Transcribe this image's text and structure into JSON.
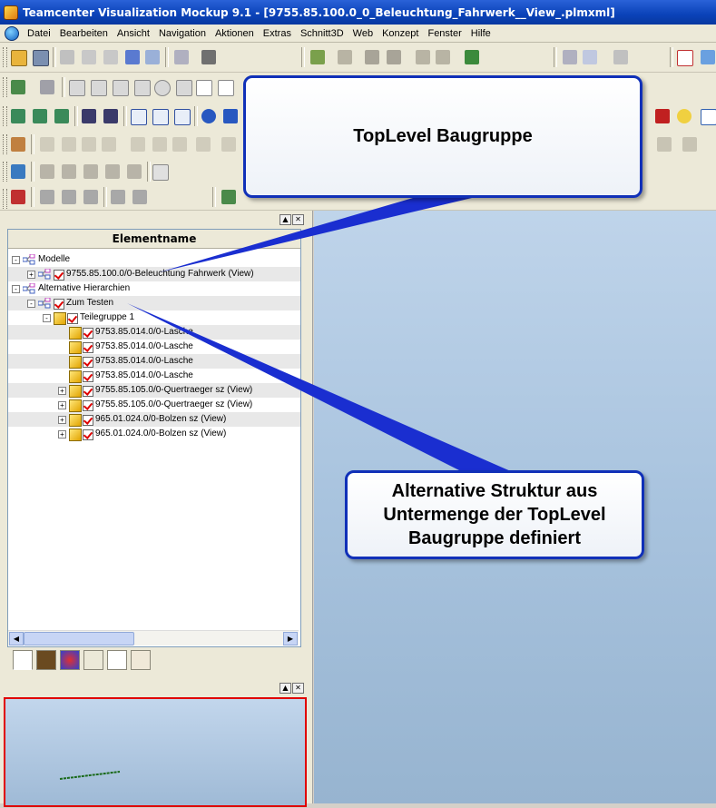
{
  "window": {
    "title": "Teamcenter Visualization Mockup 9.1 - [9755.85.100.0_0_Beleuchtung_Fahrwerk__View_.plmxml]"
  },
  "menu": [
    "Datei",
    "Bearbeiten",
    "Ansicht",
    "Navigation",
    "Aktionen",
    "Extras",
    "Schnitt3D",
    "Web",
    "Konzept",
    "Fenster",
    "Hilfe"
  ],
  "tree": {
    "column_header": "Elementname",
    "rows": [
      {
        "label": "Modelle",
        "indent": 0,
        "icon": "model-group-icon",
        "expander": "-"
      },
      {
        "label": "9755.85.100.0/0-Beleuchtung Fahrwerk (View)",
        "indent": 1,
        "icon": "model-group-icon",
        "check": true,
        "expander": "+"
      },
      {
        "label": "Alternative Hierarchien",
        "indent": 0,
        "icon": "model-group-icon",
        "expander": "-"
      },
      {
        "label": "Zum Testen",
        "indent": 1,
        "icon": "model-group-icon",
        "check": true,
        "expander": "-"
      },
      {
        "label": "Teilegruppe 1",
        "indent": 2,
        "icon": "part-group-icon",
        "check": true,
        "expander": "-"
      },
      {
        "label": "9753.85.014.0/0-Lasche",
        "indent": 3,
        "icon": "part-icon",
        "check": true,
        "expander": ""
      },
      {
        "label": "9753.85.014.0/0-Lasche",
        "indent": 3,
        "icon": "part-icon",
        "check": true,
        "expander": ""
      },
      {
        "label": "9753.85.014.0/0-Lasche",
        "indent": 3,
        "icon": "part-icon",
        "check": true,
        "expander": ""
      },
      {
        "label": "9753.85.014.0/0-Lasche",
        "indent": 3,
        "icon": "part-icon",
        "check": true,
        "expander": ""
      },
      {
        "label": "9755.85.105.0/0-Quertraeger sz (View)",
        "indent": 3,
        "icon": "part-icon",
        "check": true,
        "expander": "+"
      },
      {
        "label": "9755.85.105.0/0-Quertraeger sz (View)",
        "indent": 3,
        "icon": "part-icon",
        "check": true,
        "expander": "+"
      },
      {
        "label": "965.01.024.0/0-Bolzen sz (View)",
        "indent": 3,
        "icon": "part-icon",
        "check": true,
        "expander": "+"
      },
      {
        "label": "965.01.024.0/0-Bolzen sz (View)",
        "indent": 3,
        "icon": "part-icon",
        "check": true,
        "expander": "+"
      }
    ]
  },
  "callouts": {
    "top": "TopLevel Baugruppe",
    "bottom_line1": "Alternative Struktur aus",
    "bottom_line2": "Untermenge der TopLevel",
    "bottom_line3": "Baugruppe definiert"
  },
  "colors": {
    "callout_border": "#1030b8",
    "arrow": "#1a2ed0",
    "check": "#dd0000",
    "preview_border": "#e00000"
  }
}
